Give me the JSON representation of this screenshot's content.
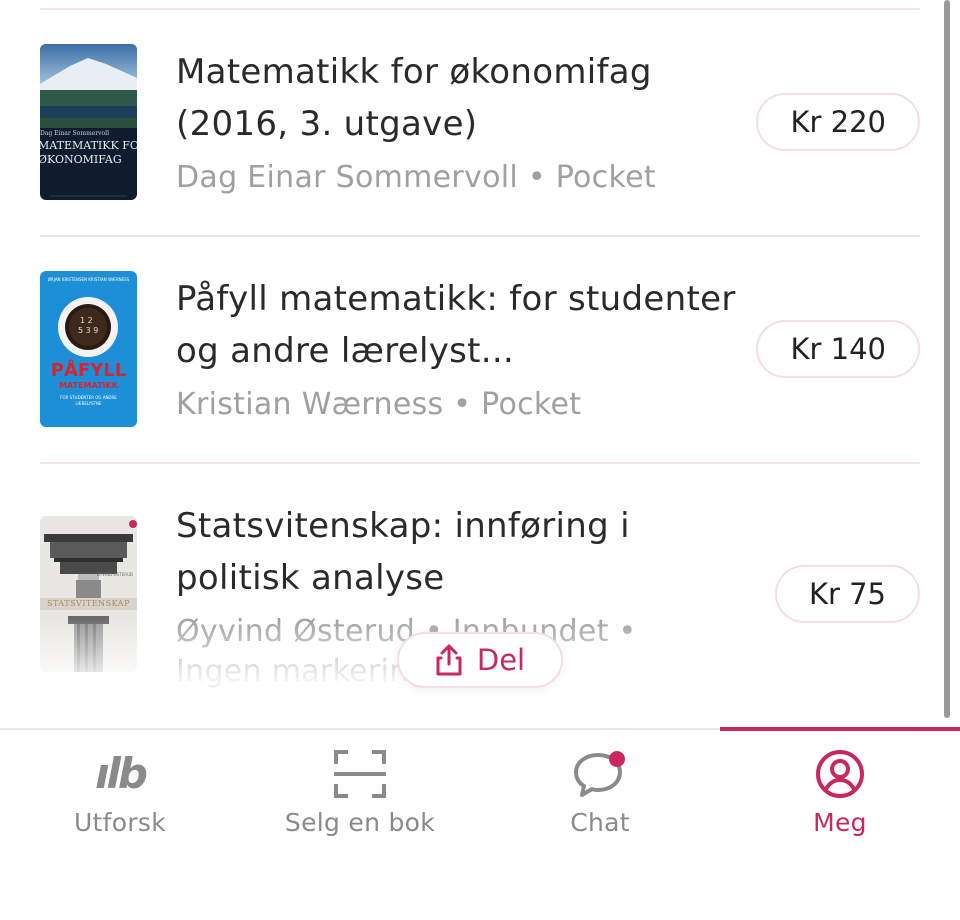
{
  "books": [
    {
      "title": "Matematikk for økonomifag (2016, 3. utgave)",
      "meta": "Dag Einar Sommervoll • Pocket",
      "price": "Kr 220",
      "cover_text_1": "Dag Einar Sommervoll",
      "cover_text_2": "MATEMATIKK FOR",
      "cover_text_3": "ØKONOMIFAG"
    },
    {
      "title": "Påfyll matematikk: for studenter og andre lærelyst...",
      "meta": "Kristian Wærness • Pocket",
      "price": "Kr 140",
      "cover_text_1": "ØRJAN KRISTENSEN KRISTIAN WÆRNESS",
      "cover_text_2": "PÅFYLL",
      "cover_text_3": "MATEMATIKK",
      "cover_text_4": "FOR STUDENTER OG ANDRE LÆRELYSTNE"
    },
    {
      "title": "Statsvitenskap: innføring i politisk analyse",
      "meta": "Øyvind Østerud • Innbundet • Ingen markering",
      "price": "Kr 75",
      "cover_text_1": "ØYVIND ØSTERUD",
      "cover_text_2": "STATSVITENSKAP"
    }
  ],
  "share": {
    "label": "Del",
    "icon": "share-icon"
  },
  "tabs": [
    {
      "label": "Utforsk",
      "icon": "logo-icon",
      "icon_text": "ılb"
    },
    {
      "label": "Selg en bok",
      "icon": "scan-icon"
    },
    {
      "label": "Chat",
      "icon": "chat-icon"
    },
    {
      "label": "Meg",
      "icon": "profile-icon"
    }
  ],
  "colors": {
    "accent": "#c8285a",
    "divider": "#f4e4ea",
    "muted_text": "#a0a0a0",
    "tab_inactive": "#8a8a8a"
  }
}
